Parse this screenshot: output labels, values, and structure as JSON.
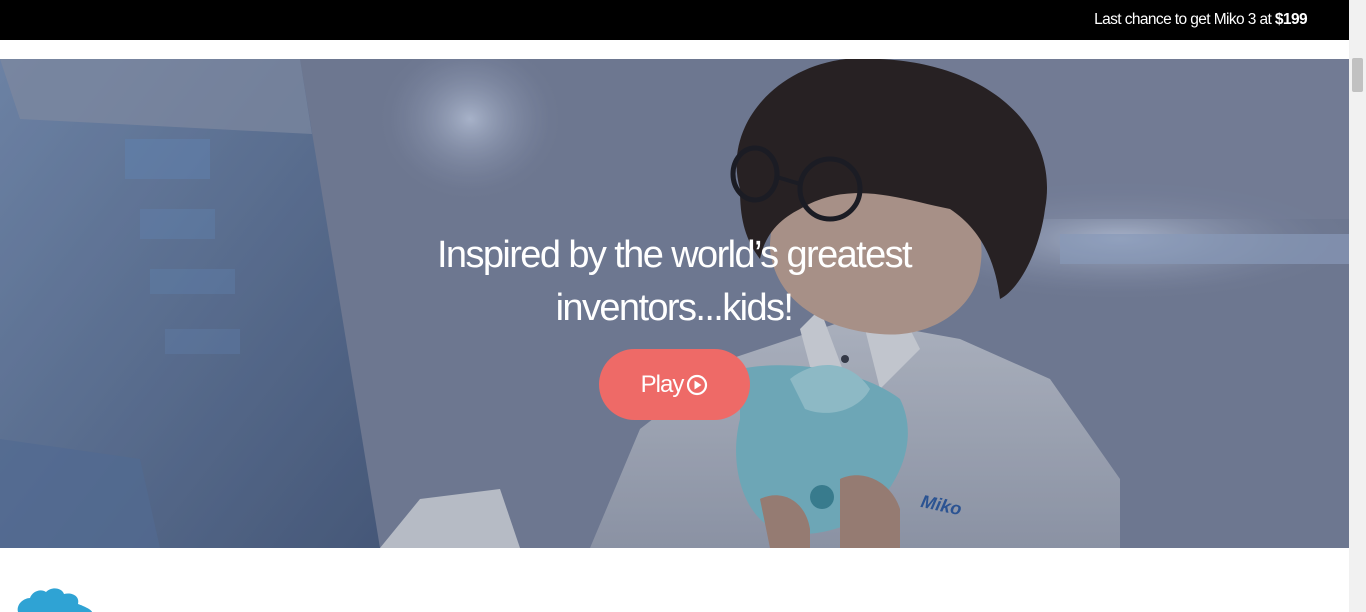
{
  "promo": {
    "text": "Last chance to get Miko 3 at",
    "price": "$199"
  },
  "hero": {
    "headline_line1": "Inspired by the world’s greatest",
    "headline_line2": "inventors...kids!",
    "play_label": "Play",
    "play_icon": "play-circle-icon",
    "robot_label": "Miko"
  },
  "colors": {
    "promo_bg": "#000000",
    "play_button": "#ee6a67",
    "robot": "#7fc4d3",
    "blob": "#2fa3d4"
  }
}
